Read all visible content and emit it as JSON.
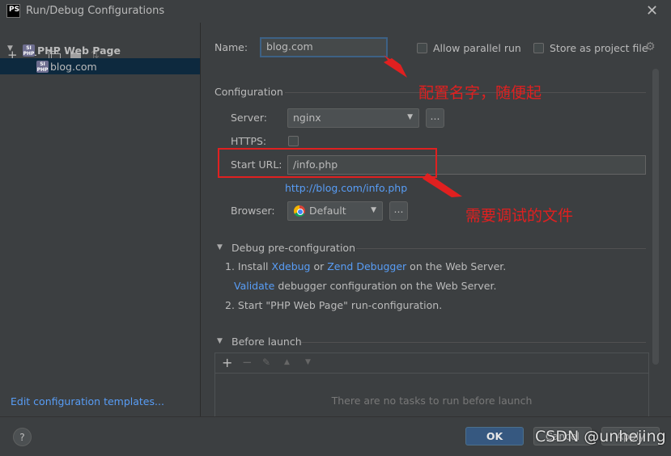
{
  "window": {
    "title": "Run/Debug Configurations",
    "logo_text": "PS"
  },
  "tree": {
    "group_label": "PHP Web Page",
    "item_label": "blog.com",
    "edit_templates_link": "Edit configuration templates..."
  },
  "name_field": {
    "label": "Name:",
    "value": "blog.com"
  },
  "options": {
    "allow_parallel": "Allow parallel run",
    "store_as_project": "Store as project file"
  },
  "configuration": {
    "section_title": "Configuration",
    "server_label": "Server:",
    "server_value": "nginx",
    "https_label": "HTTPS:",
    "start_url_label": "Start URL:",
    "start_url_value": "/info.php",
    "resolved_url": "http://blog.com/info.php",
    "browser_label": "Browser:",
    "browser_value": "Default",
    "ellipsis": "..."
  },
  "debug_pre": {
    "title": "Debug pre-configuration",
    "step1_prefix": "1. Install ",
    "xdebug": "Xdebug",
    "or": " or ",
    "zend": "Zend Debugger",
    "step1_suffix": " on the Web Server.",
    "validate": "Validate",
    "validate_suffix": " debugger configuration on the Web Server.",
    "step2": "2. Start \"PHP Web Page\" run-configuration."
  },
  "before_launch": {
    "title": "Before launch",
    "empty_text": "There are no tasks to run before launch"
  },
  "footer": {
    "help": "?",
    "ok": "OK",
    "cancel": "Cancel",
    "apply": "Apply"
  },
  "annotations": {
    "name_note": "配置名字，随便起",
    "url_note": "需要调试的文件",
    "watermark": "CSDN @unhejing"
  },
  "colors": {
    "accent": "#365880",
    "link": "#589df6",
    "annotation": "#e02020"
  }
}
